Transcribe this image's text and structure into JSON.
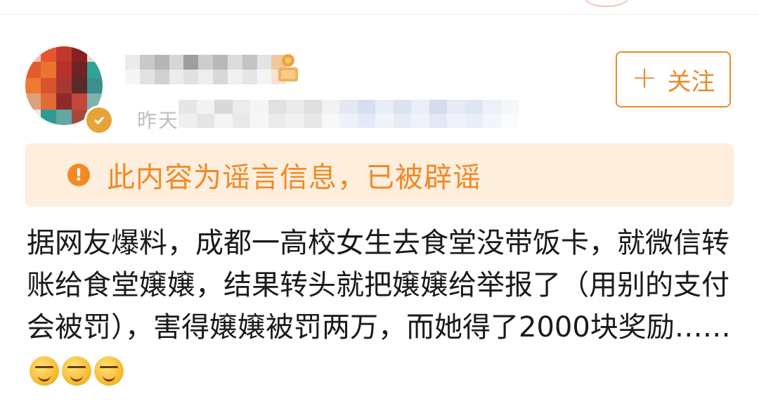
{
  "header": {
    "time_fragment": "昨天",
    "follow_button": {
      "icon": "plus-icon",
      "label": "关注"
    }
  },
  "notice": {
    "icon": "warning-icon",
    "text": "此内容为谣言信息，已被辟谣"
  },
  "post": {
    "text": "据网友爆料，成都一高校女生去食堂没带饭卡，就微信转账给食堂嬢嬢，结果转头就把嬢嬢给举报了（用别的支付会被罚），害得嬢嬢被罚两万，而她得了2000块奖励……",
    "emoji": [
      "smirk-emoji",
      "smirk-emoji",
      "smirk-emoji"
    ]
  },
  "colors": {
    "accent": "#e98b2c",
    "notice_bg": "#fdeedd",
    "notice_text": "#ef8a25",
    "body_text": "#1a1a1a"
  }
}
